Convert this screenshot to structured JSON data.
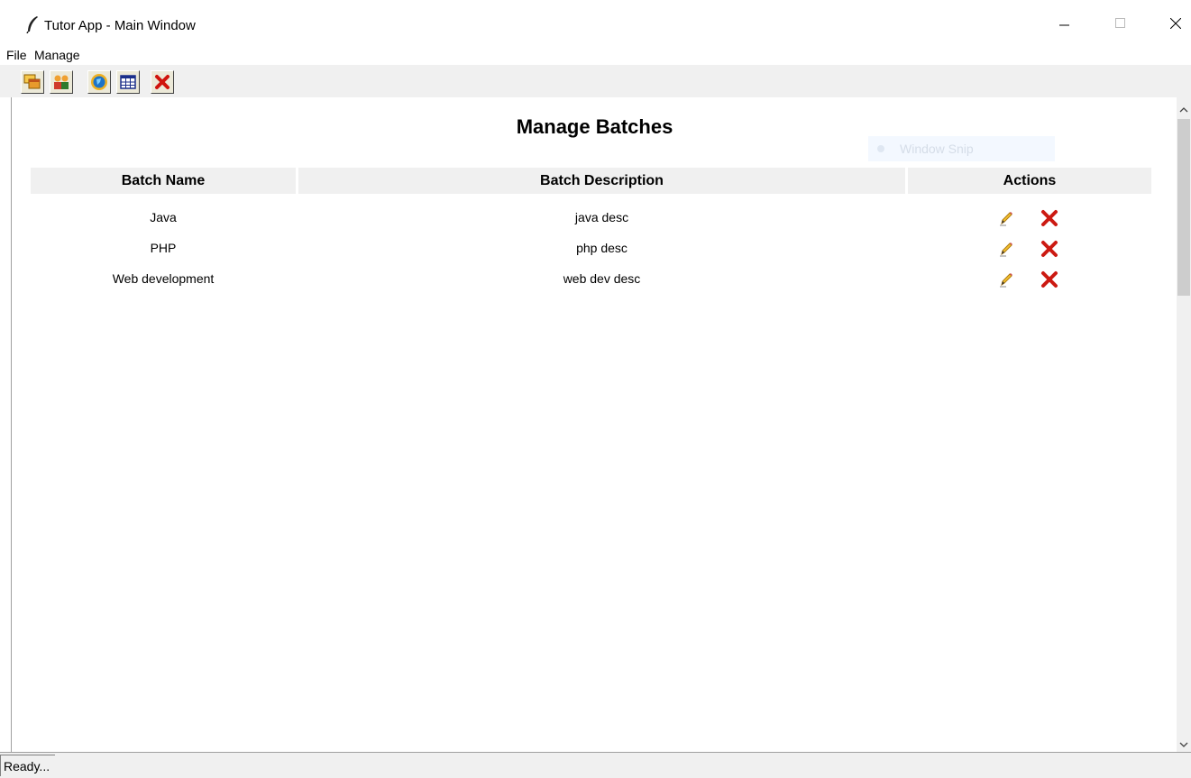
{
  "window": {
    "title": "Tutor App - Main Window",
    "icon": "feather-icon",
    "controls": [
      "minimize-icon",
      "maximize-icon",
      "close-icon"
    ]
  },
  "menubar": {
    "items": [
      {
        "label": "File"
      },
      {
        "label": "Manage"
      }
    ]
  },
  "toolbar": {
    "buttons": [
      {
        "icon": "copy-windows-icon"
      },
      {
        "icon": "users-icon"
      },
      {
        "icon": "globe-icon"
      },
      {
        "icon": "table-icon"
      },
      {
        "icon": "close-red-x-icon"
      }
    ]
  },
  "page": {
    "heading": "Manage Batches",
    "watermark": "Window Snip"
  },
  "table": {
    "headers": [
      "Batch Name",
      "Batch Description",
      "Actions"
    ],
    "rows": [
      {
        "name": "Java",
        "description": "java desc",
        "actions": [
          "edit-pencil-icon",
          "delete-x-icon"
        ]
      },
      {
        "name": "PHP",
        "description": "php desc",
        "actions": [
          "edit-pencil-icon",
          "delete-x-icon"
        ]
      },
      {
        "name": "Web development",
        "description": "web dev desc",
        "actions": [
          "edit-pencil-icon",
          "delete-x-icon"
        ]
      }
    ]
  },
  "colors": {
    "delete_red": "#cc1a12",
    "header_bg": "#f0f0f0",
    "pencil_yellow": "#f2c230"
  },
  "status": {
    "text": "Ready..."
  }
}
